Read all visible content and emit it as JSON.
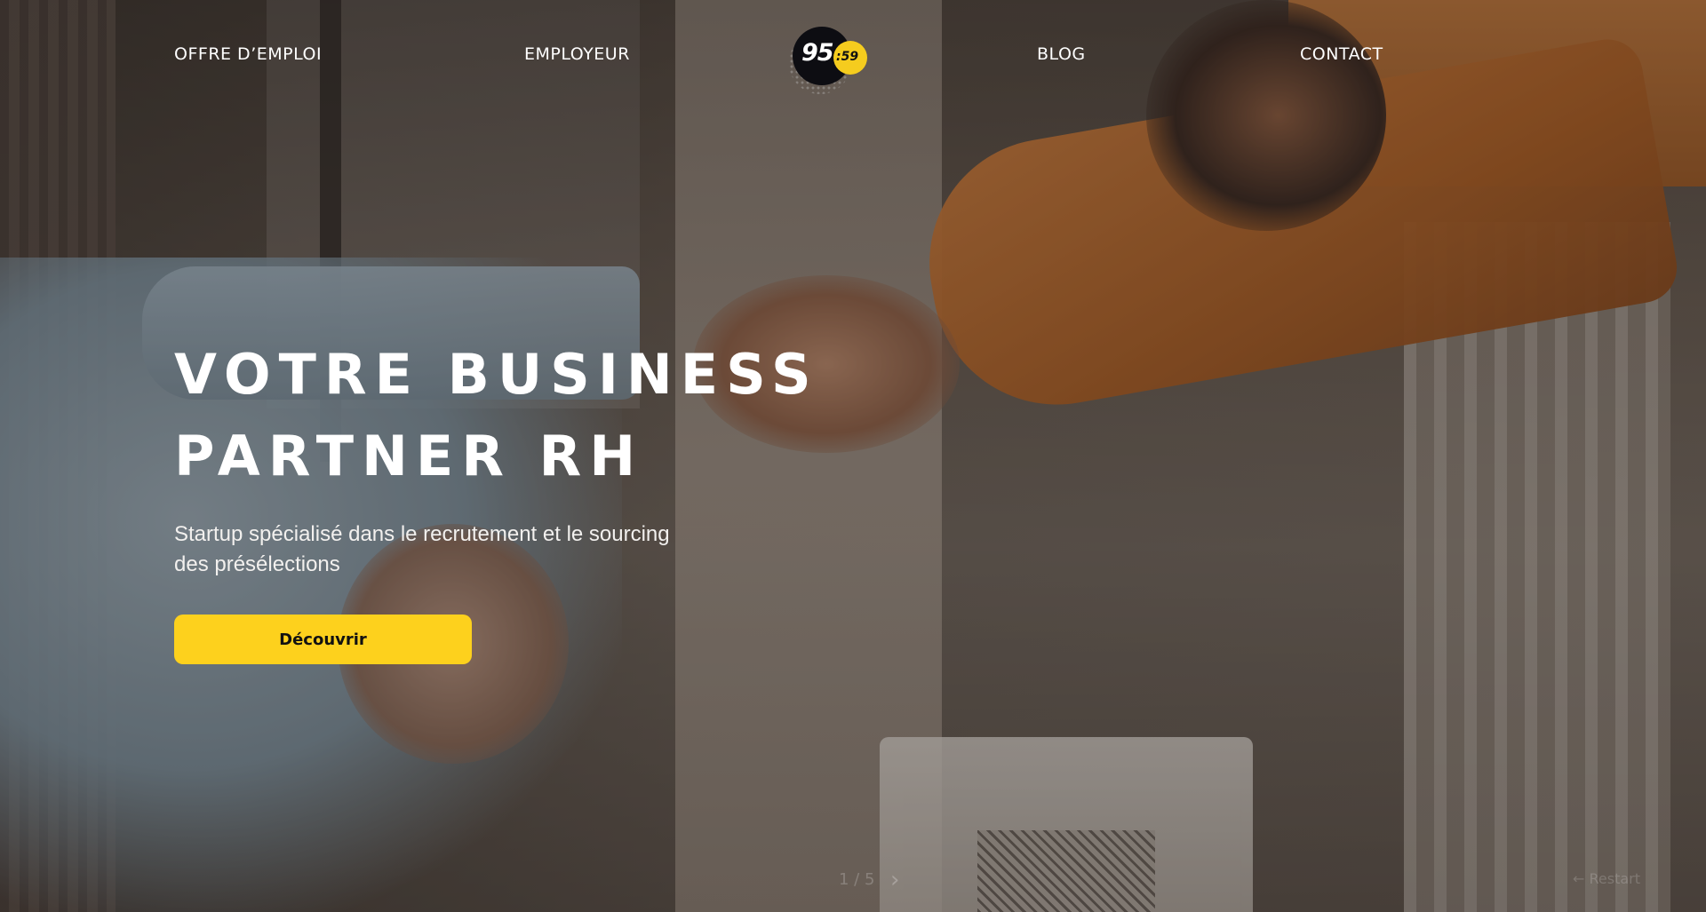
{
  "nav": {
    "offre_label": "OFFRE D’EMPLOI",
    "employeur_label": "EMPLOYEUR",
    "blog_label": "BLOG",
    "contact_label": "CONTACT"
  },
  "logo": {
    "main_text": "95",
    "badge_text": ":59",
    "colors": {
      "dark": "#0d0d12",
      "accent": "#f5cc1e"
    }
  },
  "hero": {
    "title_line_1": "VOTRE BUSINESS",
    "title_line_2": "PARTNER RH",
    "subtitle": "Startup spécialisé dans le recrutement et le sourcing des présélections",
    "cta_label": "Découvrir",
    "cta_color": "#fdd11d"
  },
  "slider": {
    "counter": "1 / 5",
    "next_icon": "chevron-right-icon"
  },
  "faint_control": {
    "label": "← Restart",
    "icon": "arrow-left-icon"
  }
}
